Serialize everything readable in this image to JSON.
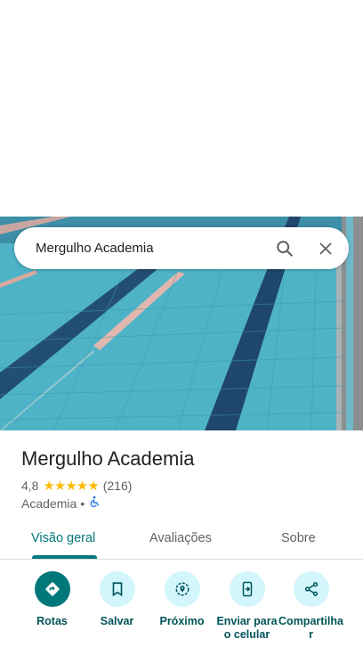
{
  "search": {
    "query": "Mergulho Academia"
  },
  "place": {
    "name": "Mergulho Academia",
    "rating": "4,8",
    "stars": "★★★★★",
    "reviews_count": "(216)",
    "category": "Academia",
    "separator": "•"
  },
  "tabs": [
    {
      "label": "Visão geral",
      "active": true
    },
    {
      "label": "Avaliações"
    },
    {
      "label": "Sobre"
    }
  ],
  "actions": [
    {
      "label": "Rotas",
      "icon": "directions-icon"
    },
    {
      "label": "Salvar",
      "icon": "bookmark-icon"
    },
    {
      "label": "Próximo",
      "icon": "nearby-icon"
    },
    {
      "label": "Enviar para o celular",
      "icon": "send-to-phone-icon"
    },
    {
      "label": "Compartilhar",
      "icon": "share-icon"
    }
  ],
  "colors": {
    "accent": "#00787a",
    "action_bg": "#d2f6fc",
    "star": "#fbbc04"
  }
}
